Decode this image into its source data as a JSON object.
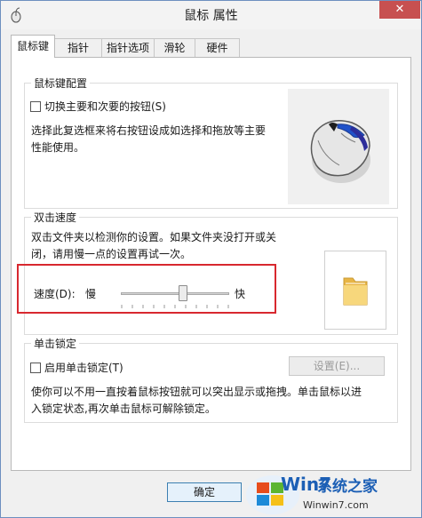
{
  "window": {
    "title": "鼠标 属性",
    "close_glyph": "✕"
  },
  "tabs": [
    {
      "label": "鼠标键",
      "active": true
    },
    {
      "label": "指针"
    },
    {
      "label": "指针选项"
    },
    {
      "label": "滑轮"
    },
    {
      "label": "硬件"
    }
  ],
  "button_config": {
    "legend": "鼠标键配置",
    "switch_checkbox_label": "切换主要和次要的按钮(S)",
    "switch_checked": false,
    "description_line1": "选择此复选框来将右按钮设成如选择和拖放等主要",
    "description_line2": "性能使用。"
  },
  "double_click": {
    "legend": "双击速度",
    "description_line1": "双击文件夹以检测你的设置。如果文件夹没打开或关",
    "description_line2": "闭，请用慢一点的设置再试一次。",
    "speed_label": "速度(D):",
    "slow_label": "慢",
    "fast_label": "快",
    "speed_level": 0.57
  },
  "click_lock": {
    "legend": "单击锁定",
    "checkbox_label": "启用单击锁定(T)",
    "checked": false,
    "settings_button": "设置(E)...",
    "description_line1": "使你可以不用一直按着鼠标按钮就可以突出显示或拖拽。单击鼠标以进",
    "description_line2": "入锁定状态,再次单击鼠标可解除锁定。"
  },
  "footer": {
    "ok_button": "确定"
  },
  "watermark": {
    "brand_text1": "Win7",
    "brand_text2": "系统之家",
    "url": "Winwin7.com"
  },
  "colors": {
    "highlight": "#d8282f",
    "close_button": "#c75050",
    "folder": "#f2c35a"
  },
  "icons": {
    "app": "mouse-app-icon",
    "folder": "folder-icon",
    "mouse": "mouse-illustration"
  }
}
